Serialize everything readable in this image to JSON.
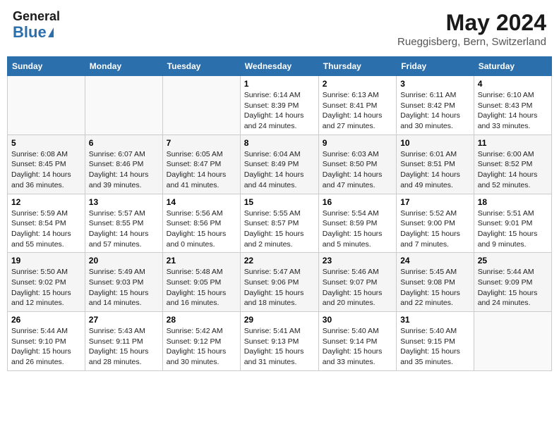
{
  "header": {
    "logo_general": "General",
    "logo_blue": "Blue",
    "month_year": "May 2024",
    "location": "Rueggisberg, Bern, Switzerland"
  },
  "weekdays": [
    "Sunday",
    "Monday",
    "Tuesday",
    "Wednesday",
    "Thursday",
    "Friday",
    "Saturday"
  ],
  "weeks": [
    [
      {
        "day": "",
        "text": ""
      },
      {
        "day": "",
        "text": ""
      },
      {
        "day": "",
        "text": ""
      },
      {
        "day": "1",
        "text": "Sunrise: 6:14 AM\nSunset: 8:39 PM\nDaylight: 14 hours and 24 minutes."
      },
      {
        "day": "2",
        "text": "Sunrise: 6:13 AM\nSunset: 8:41 PM\nDaylight: 14 hours and 27 minutes."
      },
      {
        "day": "3",
        "text": "Sunrise: 6:11 AM\nSunset: 8:42 PM\nDaylight: 14 hours and 30 minutes."
      },
      {
        "day": "4",
        "text": "Sunrise: 6:10 AM\nSunset: 8:43 PM\nDaylight: 14 hours and 33 minutes."
      }
    ],
    [
      {
        "day": "5",
        "text": "Sunrise: 6:08 AM\nSunset: 8:45 PM\nDaylight: 14 hours and 36 minutes."
      },
      {
        "day": "6",
        "text": "Sunrise: 6:07 AM\nSunset: 8:46 PM\nDaylight: 14 hours and 39 minutes."
      },
      {
        "day": "7",
        "text": "Sunrise: 6:05 AM\nSunset: 8:47 PM\nDaylight: 14 hours and 41 minutes."
      },
      {
        "day": "8",
        "text": "Sunrise: 6:04 AM\nSunset: 8:49 PM\nDaylight: 14 hours and 44 minutes."
      },
      {
        "day": "9",
        "text": "Sunrise: 6:03 AM\nSunset: 8:50 PM\nDaylight: 14 hours and 47 minutes."
      },
      {
        "day": "10",
        "text": "Sunrise: 6:01 AM\nSunset: 8:51 PM\nDaylight: 14 hours and 49 minutes."
      },
      {
        "day": "11",
        "text": "Sunrise: 6:00 AM\nSunset: 8:52 PM\nDaylight: 14 hours and 52 minutes."
      }
    ],
    [
      {
        "day": "12",
        "text": "Sunrise: 5:59 AM\nSunset: 8:54 PM\nDaylight: 14 hours and 55 minutes."
      },
      {
        "day": "13",
        "text": "Sunrise: 5:57 AM\nSunset: 8:55 PM\nDaylight: 14 hours and 57 minutes."
      },
      {
        "day": "14",
        "text": "Sunrise: 5:56 AM\nSunset: 8:56 PM\nDaylight: 15 hours and 0 minutes."
      },
      {
        "day": "15",
        "text": "Sunrise: 5:55 AM\nSunset: 8:57 PM\nDaylight: 15 hours and 2 minutes."
      },
      {
        "day": "16",
        "text": "Sunrise: 5:54 AM\nSunset: 8:59 PM\nDaylight: 15 hours and 5 minutes."
      },
      {
        "day": "17",
        "text": "Sunrise: 5:52 AM\nSunset: 9:00 PM\nDaylight: 15 hours and 7 minutes."
      },
      {
        "day": "18",
        "text": "Sunrise: 5:51 AM\nSunset: 9:01 PM\nDaylight: 15 hours and 9 minutes."
      }
    ],
    [
      {
        "day": "19",
        "text": "Sunrise: 5:50 AM\nSunset: 9:02 PM\nDaylight: 15 hours and 12 minutes."
      },
      {
        "day": "20",
        "text": "Sunrise: 5:49 AM\nSunset: 9:03 PM\nDaylight: 15 hours and 14 minutes."
      },
      {
        "day": "21",
        "text": "Sunrise: 5:48 AM\nSunset: 9:05 PM\nDaylight: 15 hours and 16 minutes."
      },
      {
        "day": "22",
        "text": "Sunrise: 5:47 AM\nSunset: 9:06 PM\nDaylight: 15 hours and 18 minutes."
      },
      {
        "day": "23",
        "text": "Sunrise: 5:46 AM\nSunset: 9:07 PM\nDaylight: 15 hours and 20 minutes."
      },
      {
        "day": "24",
        "text": "Sunrise: 5:45 AM\nSunset: 9:08 PM\nDaylight: 15 hours and 22 minutes."
      },
      {
        "day": "25",
        "text": "Sunrise: 5:44 AM\nSunset: 9:09 PM\nDaylight: 15 hours and 24 minutes."
      }
    ],
    [
      {
        "day": "26",
        "text": "Sunrise: 5:44 AM\nSunset: 9:10 PM\nDaylight: 15 hours and 26 minutes."
      },
      {
        "day": "27",
        "text": "Sunrise: 5:43 AM\nSunset: 9:11 PM\nDaylight: 15 hours and 28 minutes."
      },
      {
        "day": "28",
        "text": "Sunrise: 5:42 AM\nSunset: 9:12 PM\nDaylight: 15 hours and 30 minutes."
      },
      {
        "day": "29",
        "text": "Sunrise: 5:41 AM\nSunset: 9:13 PM\nDaylight: 15 hours and 31 minutes."
      },
      {
        "day": "30",
        "text": "Sunrise: 5:40 AM\nSunset: 9:14 PM\nDaylight: 15 hours and 33 minutes."
      },
      {
        "day": "31",
        "text": "Sunrise: 5:40 AM\nSunset: 9:15 PM\nDaylight: 15 hours and 35 minutes."
      },
      {
        "day": "",
        "text": ""
      }
    ]
  ]
}
